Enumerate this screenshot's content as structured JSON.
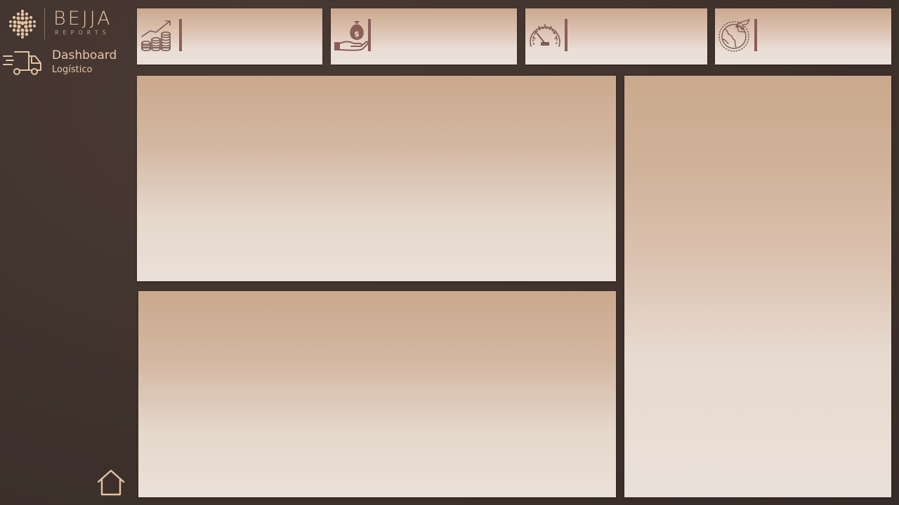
{
  "brand": {
    "name": "BEJJA",
    "sub": "REPORTS"
  },
  "header": {
    "title": "Dashboard",
    "subtitle": "Logístico"
  },
  "icons": {
    "logo": "bejja-logo-icon",
    "truck": "delivery-truck-icon",
    "home": "home-icon",
    "kpi_1": "growth-coins-icon",
    "kpi_2": "money-bag-hand-icon",
    "kpi_3": "speedometer-icon",
    "kpi_4": "globe-plane-icon"
  },
  "colors": {
    "background": "#3f322d",
    "accent_text": "#e5c7a8",
    "icon_stroke": "#8b5e5a",
    "card_top": "#c9a88d",
    "card_bottom": "#ebe1d9"
  }
}
